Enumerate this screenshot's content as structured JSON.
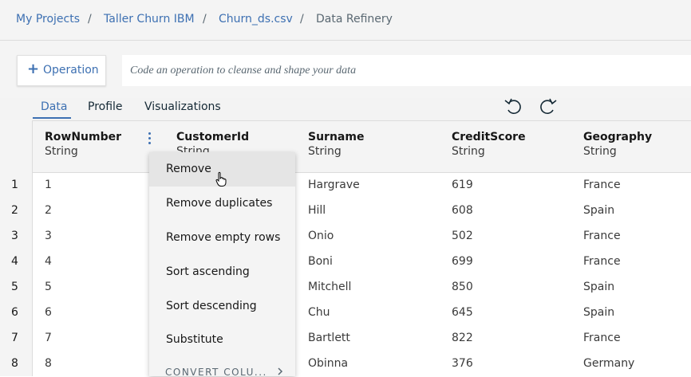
{
  "breadcrumb": {
    "items": [
      "My Projects",
      "Taller Churn IBM",
      "Churn_ds.csv",
      "Data Refinery"
    ],
    "separator": "/"
  },
  "toolbar": {
    "operation_label": "Operation",
    "command_placeholder": "Code an operation to cleanse and shape your data"
  },
  "tabs": [
    "Data",
    "Profile",
    "Visualizations"
  ],
  "table": {
    "columns": [
      {
        "name": "RowNumber",
        "type": "String"
      },
      {
        "name": "CustomerId",
        "type": "String"
      },
      {
        "name": "Surname",
        "type": "String"
      },
      {
        "name": "CreditScore",
        "type": "String"
      },
      {
        "name": "Geography",
        "type": "String"
      }
    ],
    "row_numbers": [
      "1",
      "2",
      "3",
      "4",
      "5",
      "6",
      "7",
      "8"
    ],
    "rows": [
      [
        "1",
        "Hargrave",
        "619",
        "France"
      ],
      [
        "2",
        "Hill",
        "608",
        "Spain"
      ],
      [
        "3",
        "Onio",
        "502",
        "France"
      ],
      [
        "4",
        "Boni",
        "699",
        "France"
      ],
      [
        "5",
        "Mitchell",
        "850",
        "Spain"
      ],
      [
        "6",
        "Chu",
        "645",
        "Spain"
      ],
      [
        "7",
        "Bartlett",
        "822",
        "France"
      ],
      [
        "8",
        "Obinna",
        "376",
        "Germany"
      ]
    ]
  },
  "column_menu": {
    "items": [
      "Remove",
      "Remove duplicates",
      "Remove empty rows",
      "Sort ascending",
      "Sort descending",
      "Substitute"
    ],
    "section": "CONVERT COLU..."
  },
  "colors": {
    "accent": "#3d70b2",
    "background": "#f3f3f3"
  },
  "icons": [
    "undo-icon",
    "redo-icon",
    "overflow-menu-icon",
    "chevron-right-icon",
    "hand-cursor-icon"
  ]
}
